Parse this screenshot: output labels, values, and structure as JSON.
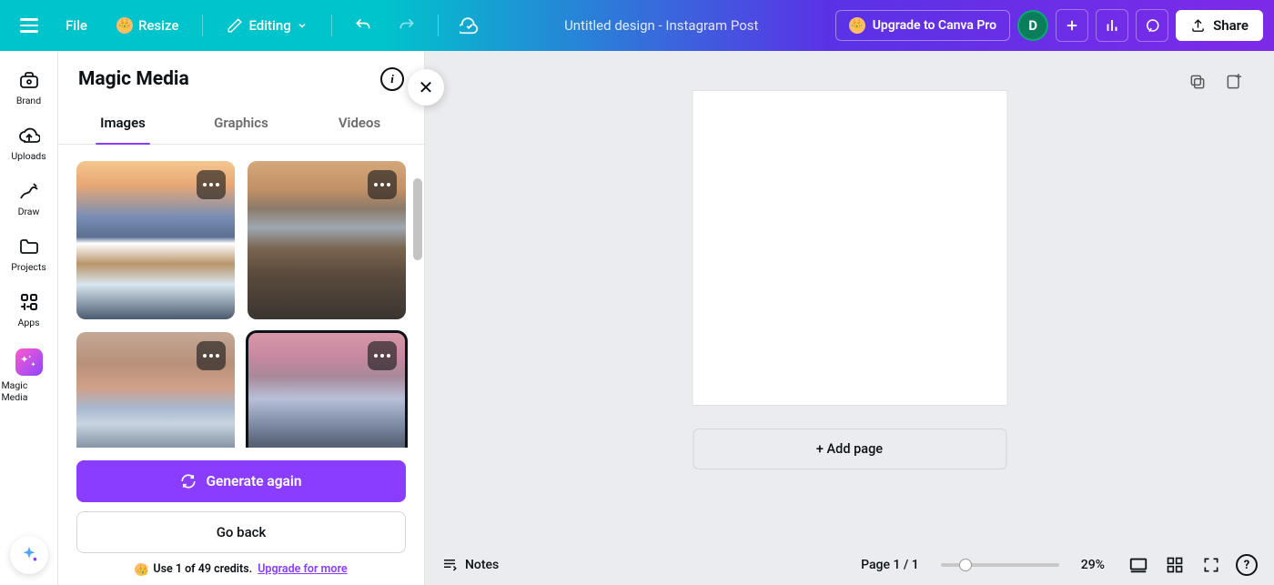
{
  "topbar": {
    "file_label": "File",
    "resize_label": "Resize",
    "editing_label": "Editing",
    "doc_title": "Untitled design - Instagram Post",
    "upgrade_label": "Upgrade to Canva Pro",
    "avatar_initial": "D",
    "share_label": "Share"
  },
  "rail": {
    "items": [
      {
        "label": "Brand"
      },
      {
        "label": "Uploads"
      },
      {
        "label": "Draw"
      },
      {
        "label": "Projects"
      },
      {
        "label": "Apps"
      },
      {
        "label": "Magic Media"
      }
    ]
  },
  "panel": {
    "title": "Magic Media",
    "tabs": {
      "images": "Images",
      "graphics": "Graphics",
      "videos": "Videos"
    },
    "generate_label": "Generate again",
    "back_label": "Go back",
    "credits_prefix": "Use 1 of 49 credits.",
    "credits_link": "Upgrade for more"
  },
  "canvas": {
    "add_page_label": "+ Add page"
  },
  "bottombar": {
    "notes_label": "Notes",
    "page_label": "Page 1 / 1",
    "zoom_label": "29%"
  }
}
